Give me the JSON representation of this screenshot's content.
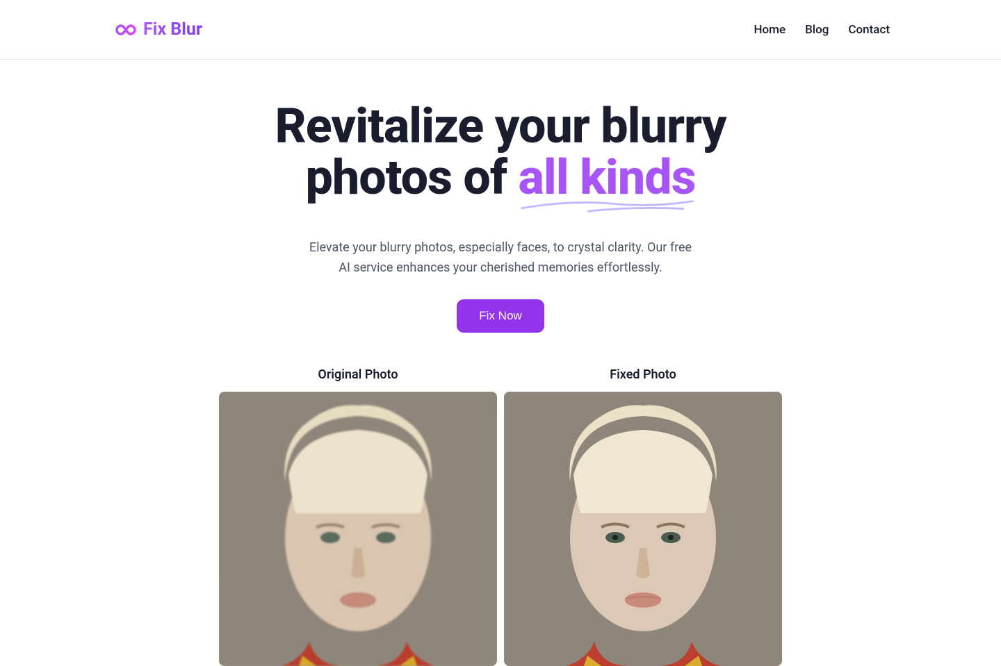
{
  "brand": {
    "name": "Fix Blur"
  },
  "nav": {
    "items": [
      {
        "label": "Home"
      },
      {
        "label": "Blog"
      },
      {
        "label": "Contact"
      }
    ]
  },
  "hero": {
    "title_line1": "Revitalize your blurry",
    "title_line2_prefix": "photos of ",
    "title_accent": "all kinds",
    "subtitle": "Elevate your blurry photos, especially faces, to crystal clarity. Our free AI service enhances your cherished memories effortlessly.",
    "cta_label": "Fix Now"
  },
  "comparison": {
    "original_label": "Original Photo",
    "fixed_label": "Fixed Photo"
  },
  "colors": {
    "accent": "#a855f7",
    "button": "#9333ea",
    "text_dark": "#1a1d2e",
    "text_muted": "#4b5563"
  }
}
